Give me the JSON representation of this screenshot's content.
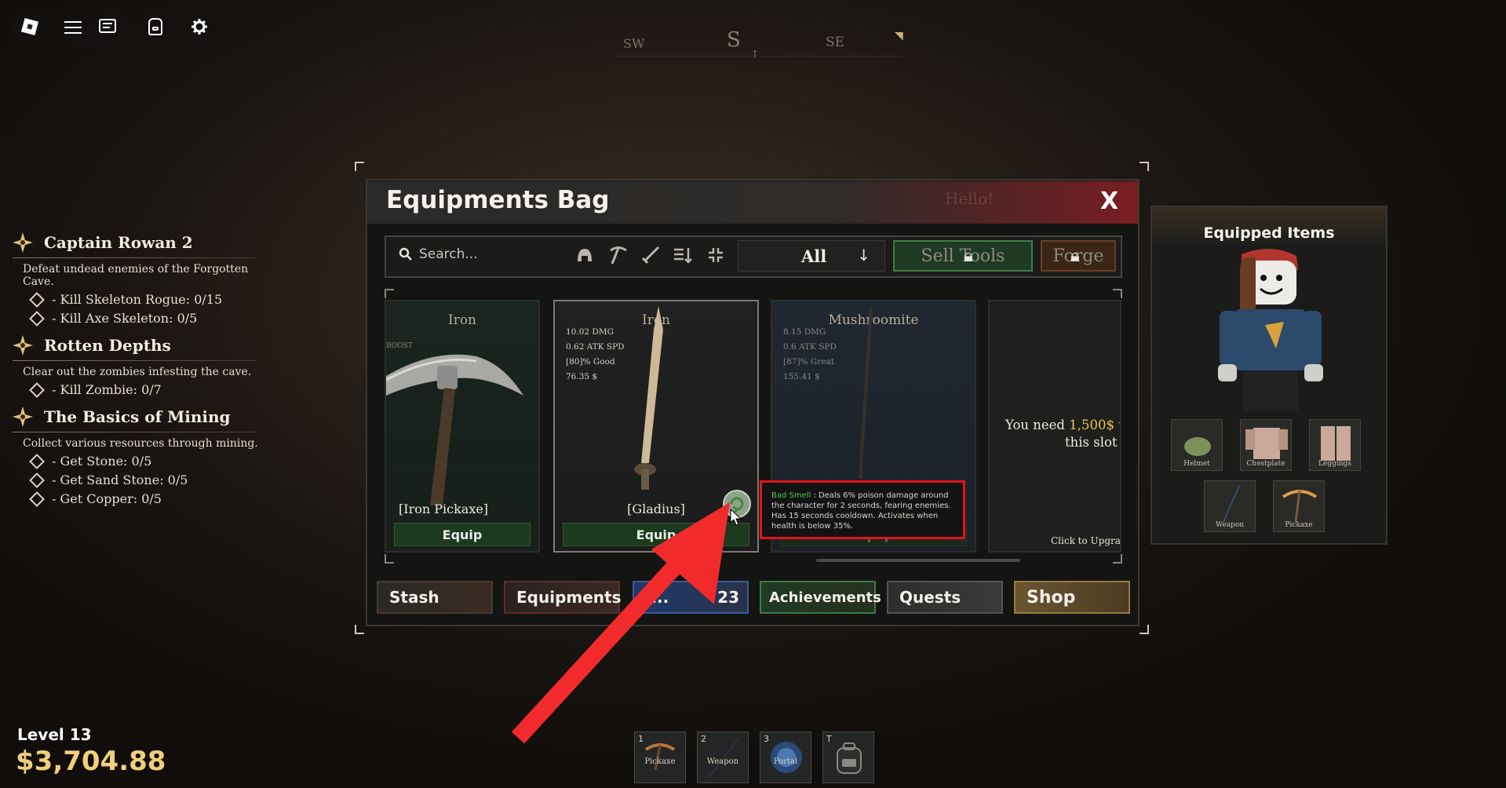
{
  "topbar": {
    "roblox_icon": "roblox-logo-icon",
    "menu_icon": "hamburger-menu-icon",
    "chat_icon": "chat-icon",
    "backpack_icon": "backpack-icon",
    "settings_icon": "gear-icon"
  },
  "compass": {
    "sw": "SW",
    "s": "S",
    "se": "SE"
  },
  "quests": [
    {
      "title": "Captain Rowan 2",
      "desc": "Defeat undead enemies of the Forgotten Cave.",
      "tasks": [
        "- Kill Skeleton Rogue: 0/15",
        "- Kill Axe Skeleton: 0/5"
      ]
    },
    {
      "title": "Rotten Depths",
      "desc": "Clear out the zombies infesting the cave.",
      "tasks": [
        "- Kill Zombie: 0/7"
      ]
    },
    {
      "title": "The Basics of Mining",
      "desc": "Collect various resources through mining.",
      "tasks": [
        "- Get Stone: 0/5",
        "- Get Sand Stone: 0/5",
        "- Get Copper: 0/5"
      ]
    }
  ],
  "player": {
    "level": "Level 13",
    "money": "$3,704.88"
  },
  "window": {
    "title": "Equipments Bag",
    "close": "X",
    "hello": "Hello!",
    "search_placeholder": "Search...",
    "filter": "All",
    "sell_tools": "Sell Tools",
    "forge": "Forge"
  },
  "cards": [
    {
      "title": "Iron",
      "boost": "BOOST",
      "name": "[Iron Pickaxe]",
      "button": "Equip"
    },
    {
      "title": "Iron",
      "stats": [
        "10.02 DMG",
        "0.62 ATK SPD",
        "[80]% Good",
        "76.35 $"
      ],
      "name": "[Gladius]",
      "button": "Equip"
    },
    {
      "title": "Mushroomite",
      "stats": [
        "8.15 DMG",
        "0.6 ATK SPD",
        "[87]% Great",
        "155.41 $"
      ],
      "button": "Equip"
    },
    {
      "need_prefix": "You need ",
      "need_amount": "1,500$",
      "need_suffix": " t",
      "need_line2": "this slot",
      "upgrade": "Click to Upgrad"
    }
  ],
  "tooltip": {
    "name": "Bad Smell",
    "text": " : Deals 6% poison damage around the character for 2 seconds, fearing enemies. Has 15 seconds cooldown. Activates when health is below 35%."
  },
  "tabs": {
    "stash": "Stash",
    "equipments": "Equipments",
    "inventory_partial": "I...",
    "inventory_count": "23",
    "achievements": "Achievements",
    "quests": "Quests",
    "shop": "Shop"
  },
  "equipped": {
    "title": "Equipped Items",
    "slots": [
      "Helmet",
      "Chestplate",
      "Leggings",
      "Weapon",
      "Pickaxe"
    ]
  },
  "hotbar": [
    {
      "key": "1",
      "label": "Pickaxe"
    },
    {
      "key": "2",
      "label": "Weapon"
    },
    {
      "key": "3",
      "label": "Portal"
    },
    {
      "key": "T",
      "label": ""
    }
  ],
  "colors": {
    "accent_red": "#e0141a",
    "equip_green": "#1c3a20",
    "money_gold": "#f1cf7a",
    "need_gold": "#f0c24a"
  }
}
